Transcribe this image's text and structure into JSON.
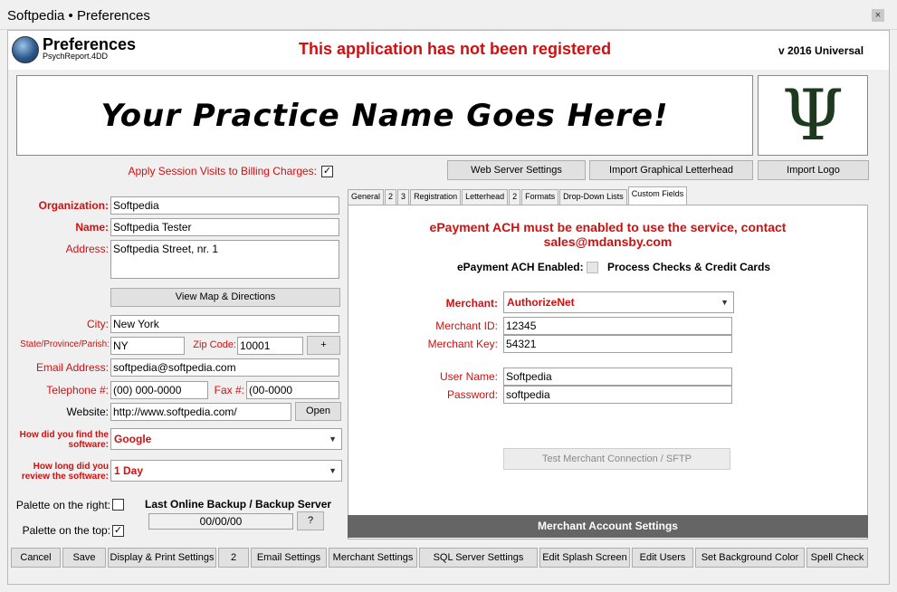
{
  "window": {
    "title": "Softpedia  • Preferences",
    "close_label": "×"
  },
  "header": {
    "title": "Preferences",
    "subtitle": "PsychReport.4DD",
    "unregistered": "This application has not been registered",
    "version": "v 2016 Universal"
  },
  "banner": {
    "text": "Your Practice Name Goes Here!",
    "logo_glyph": "Ψ"
  },
  "left": {
    "apply_label": "Apply Session Visits to Billing Charges:",
    "apply_checked": "✓",
    "organization_label": "Organization:",
    "organization_value": "Softpedia",
    "name_label": "Name:",
    "name_value": "Softpedia Tester",
    "address_label": "Address:",
    "address_value": "Softpedia Street, nr. 1",
    "map_button": "View Map & Directions",
    "city_label": "City:",
    "city_value": "New York",
    "state_label": "State/Province/Parish:",
    "state_value": "NY",
    "zip_label": "Zip Code:",
    "zip_value": "10001",
    "plus_button": "+",
    "email_label": "Email Address:",
    "email_value": "softpedia@softpedia.com",
    "phone_label": "Telephone #:",
    "phone_value": "(00) 000-0000",
    "fax_label": "Fax #:",
    "fax_value": "(00-0000",
    "website_label": "Website:",
    "website_value": "http://www.softpedia.com/",
    "open_button": "Open",
    "found_label_1": "How did you find the",
    "found_label_2": "software:",
    "found_value": "Google",
    "review_label_1": "How long did you",
    "review_label_2": "review the software:",
    "review_value": "1 Day",
    "palette_right_label": "Palette on the right:",
    "palette_right_checked": "",
    "palette_top_label": "Palette on the top:",
    "palette_top_checked": "✓",
    "backup_title": "Last Online Backup / Backup Server",
    "backup_value": "00/00/00",
    "backup_help": "?"
  },
  "top_buttons": {
    "web_server": "Web Server Settings",
    "import_letterhead": "Import Graphical Letterhead",
    "import_logo": "Import Logo"
  },
  "tabs": [
    "General",
    "2",
    "3",
    "Registration",
    "Letterhead",
    "2",
    "Formats",
    "Drop-Down Lists",
    "Custom Fields"
  ],
  "panel": {
    "warning_1": "ePayment ACH must be enabled to use the service, contact",
    "warning_2": "sales@mdansby.com",
    "ach_label": "ePayment ACH Enabled:",
    "ach_desc": "Process Checks & Credit Cards",
    "merchant_label": "Merchant:",
    "merchant_value": "AuthorizeNet",
    "merchant_id_label": "Merchant ID:",
    "merchant_id_value": "12345",
    "merchant_key_label": "Merchant Key:",
    "merchant_key_value": "54321",
    "username_label": "User Name:",
    "username_value": "Softpedia",
    "password_label": "Password:",
    "password_value": "softpedia",
    "test_button": "Test Merchant Connection / SFTP",
    "footer": "Merchant Account Settings"
  },
  "bottom_buttons": [
    "Cancel",
    "Save",
    "Display & Print Settings",
    "2",
    "Email Settings",
    "Merchant Settings",
    "SQL Server Settings",
    "Edit Splash Screen",
    "Edit Users",
    "Set Background Color",
    "Spell Check"
  ],
  "colors": {
    "label_red": "#d01010",
    "panel_footer": "#656565"
  }
}
